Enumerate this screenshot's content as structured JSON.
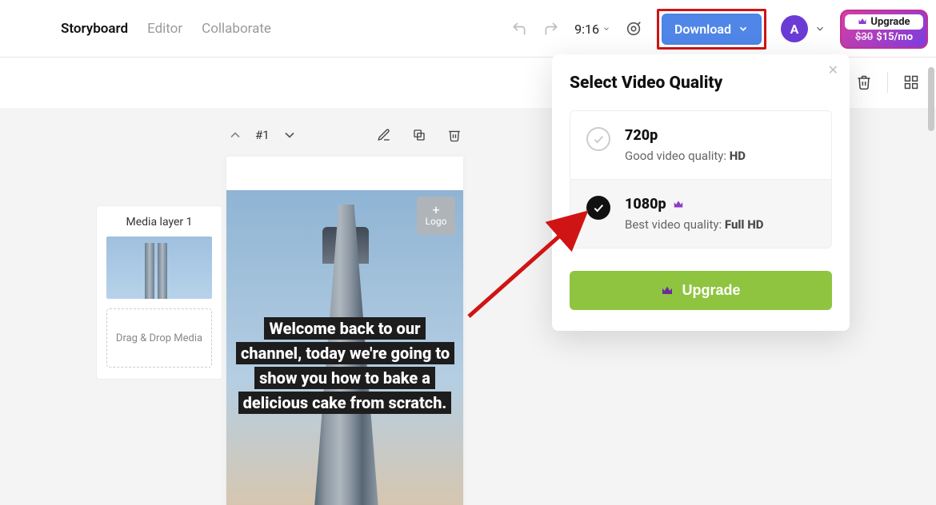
{
  "nav": {
    "storyboard": "Storyboard",
    "editor": "Editor",
    "collaborate": "Collaborate"
  },
  "toolbar": {
    "time": "9:16",
    "download": "Download"
  },
  "account": {
    "initial": "A"
  },
  "upgrade_pill": {
    "label": "Upgrade",
    "old_price": "$30",
    "new_price": "$15/mo"
  },
  "scene": {
    "number": "#1",
    "logo_label": "Logo",
    "caption": "Welcome back to our channel, today we're going to show you how to bake a delicious cake from scratch."
  },
  "media_panel": {
    "title": "Media layer 1",
    "dropzone": "Drag & Drop Media"
  },
  "popover": {
    "title": "Select Video Quality",
    "options": [
      {
        "label": "720p",
        "desc_prefix": "Good video quality: ",
        "desc_bold": "HD",
        "premium": false,
        "selected": false
      },
      {
        "label": "1080p",
        "desc_prefix": "Best video quality: ",
        "desc_bold": "Full HD",
        "premium": true,
        "selected": true
      }
    ],
    "upgrade_label": "Upgrade"
  }
}
